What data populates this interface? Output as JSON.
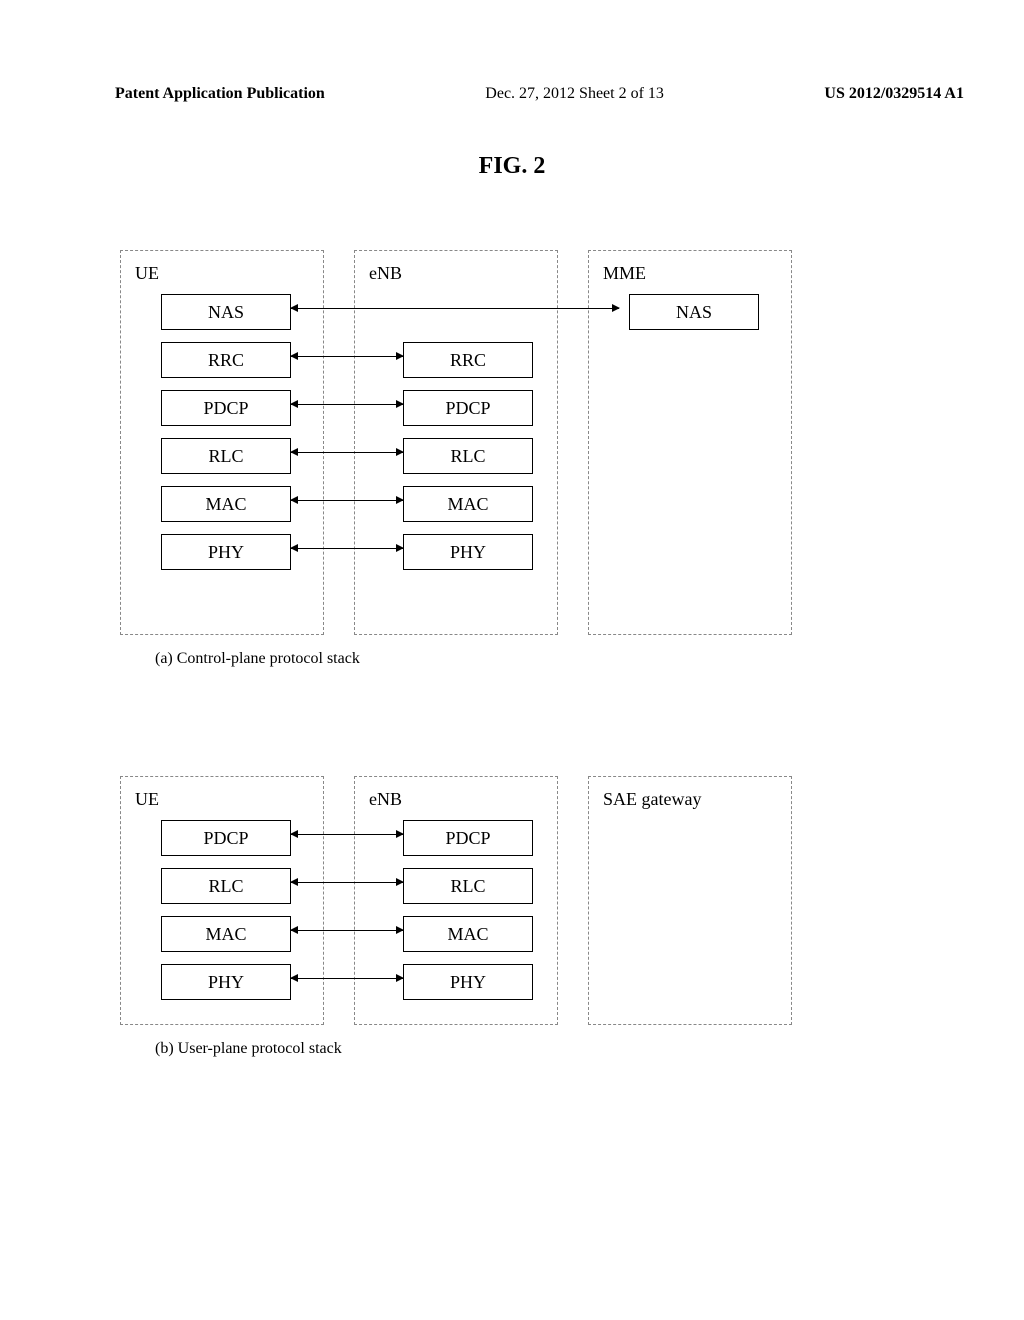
{
  "header": {
    "left": "Patent Application Publication",
    "center": "Dec. 27, 2012  Sheet 2 of 13",
    "right": "US 2012/0329514 A1"
  },
  "figure_title": "FIG. 2",
  "diagram_a": {
    "caption": "(a) Control-plane protocol stack",
    "entities": {
      "ue": {
        "label": "UE",
        "layers": [
          "NAS",
          "RRC",
          "PDCP",
          "RLC",
          "MAC",
          "PHY"
        ]
      },
      "enb": {
        "label": "eNB",
        "layers": [
          "RRC",
          "PDCP",
          "RLC",
          "MAC",
          "PHY"
        ]
      },
      "mme": {
        "label": "MME",
        "layers": [
          "NAS"
        ]
      }
    }
  },
  "diagram_b": {
    "caption": "(b) User-plane protocol stack",
    "entities": {
      "ue": {
        "label": "UE",
        "layers": [
          "PDCP",
          "RLC",
          "MAC",
          "PHY"
        ]
      },
      "enb": {
        "label": "eNB",
        "layers": [
          "PDCP",
          "RLC",
          "MAC",
          "PHY"
        ]
      },
      "sae": {
        "label": "SAE gateway"
      }
    }
  }
}
